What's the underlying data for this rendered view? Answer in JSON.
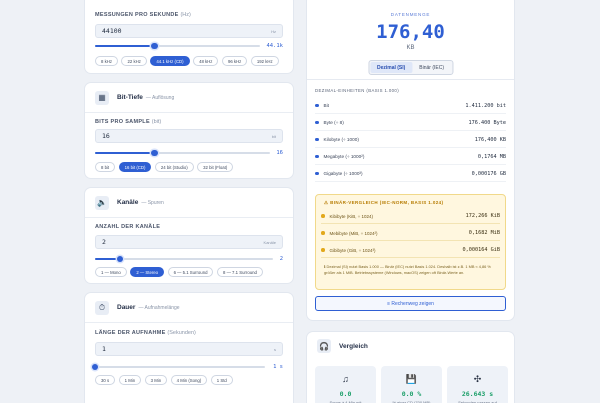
{
  "sampling": {
    "label": "Messungen pro Sekunde",
    "hint": "(Hz)",
    "value": "44100",
    "unit": "Hz",
    "slider_value": "44.1k",
    "slider_fraction": 0.36,
    "presets": [
      "8 kHz",
      "22 kHz",
      "44.1 kHz (CD)",
      "48 kHz",
      "96 kHz",
      "192 kHz"
    ],
    "active_preset": 2
  },
  "bitdepth": {
    "title": "Bit-Tiefe",
    "subtitle": "— Auflösung",
    "icon": "chip-icon",
    "label": "Bits pro Sample",
    "hint": "(bit)",
    "value": "16",
    "unit": "bit",
    "slider_value": "16",
    "slider_fraction": 0.34,
    "presets": [
      "8 bit",
      "16 bit (CD)",
      "24 bit (Studio)",
      "32 bit (Float)"
    ],
    "active_preset": 1
  },
  "channels": {
    "title": "Kanäle",
    "subtitle": "— Spuren",
    "icon": "speaker-icon",
    "label": "Anzahl der Kanäle",
    "hint": "",
    "value": "2",
    "unit": "Kanäle",
    "slider_value": "2",
    "slider_fraction": 0.14,
    "presets": [
      "1 — Mono",
      "2 — Stereo",
      "6 — 5.1 Surround",
      "8 — 7.1 Surround"
    ],
    "active_preset": 1
  },
  "duration": {
    "title": "Dauer",
    "subtitle": "— Aufnahmelänge",
    "icon": "timer-icon",
    "label": "Länge der Aufnahme",
    "hint": "(Sekunden)",
    "value": "1",
    "unit": "s",
    "slider_value": "1 s",
    "slider_fraction": 0.0,
    "presets": [
      "30 s",
      "1 Min",
      "3 Min",
      "4 Min (Song)",
      "1 Std"
    ]
  },
  "result": {
    "label": "Datenmenge",
    "value": "176,40",
    "unit": "KB",
    "toggle": [
      "Dezimal (SI)",
      "Binär (IEC)"
    ],
    "active_toggle": 0
  },
  "decimal": {
    "label": "Dezimal-Einheiten (Basis 1.000)",
    "rows": [
      {
        "name": "Bit",
        "value": "1.411.200 bit"
      },
      {
        "name": "Byte (÷ 8)",
        "value": "176.400 Byte"
      },
      {
        "name": "Kilobyte (÷ 1000)",
        "value": "176,400 KB"
      },
      {
        "name": "Megabyte (÷ 1000²)",
        "value": "0,1764 MB"
      },
      {
        "name": "Gigabyte (÷ 1000³)",
        "value": "0,000176 GB"
      }
    ]
  },
  "binary": {
    "title": "⚠ Binär-Vergleich (IEC-Norm, Basis 1.024)",
    "rows": [
      {
        "name": "Kibibyte (KiB, ÷ 1024)",
        "value": "172,266 KiB"
      },
      {
        "name": "Mebibyte (MiB, ÷ 1024²)",
        "value": "0,1682 MiB"
      },
      {
        "name": "Gibibyte (GiB, ÷ 1024³)",
        "value": "0,000164 GiB"
      }
    ],
    "note": "ℹ Dezimal (SI) nutzt Basis 1.000 — Binär (IEC) nutzt Basis 1.024. Deshalb ist z.B. 1 MB ≈ 4,86 % größer als 1 MiB. Betriebssysteme (Windows, macOS) zeigen oft Binär-Werte an."
  },
  "calc_button": "≡  Rechenweg zeigen",
  "compare": {
    "title": "Vergleich",
    "icon": "headphones-icon",
    "stats": [
      {
        "icon": "♫",
        "icon_name": "music-note-icon",
        "value": "0.0",
        "caption": "Songs à 4 Min mit"
      },
      {
        "icon": "💾",
        "icon_name": "floppy-disk-icon",
        "value": "0.0 %",
        "caption": "% einer CD (700 MB)"
      },
      {
        "icon": "✣",
        "icon_name": "puzzle-icon",
        "value": "26.643 s",
        "caption": "Sekunden passen auf"
      }
    ]
  }
}
